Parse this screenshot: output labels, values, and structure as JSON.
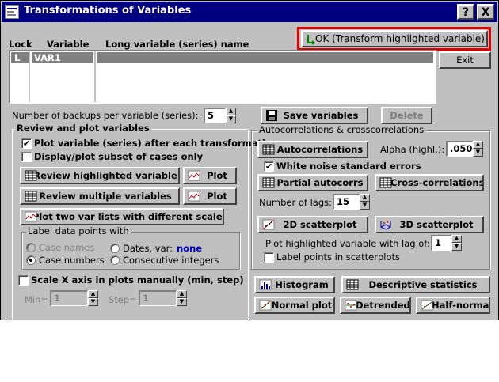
{
  "window": {
    "title": "Transformations of Variables",
    "help_label": "?",
    "close_label": "X"
  },
  "list": {
    "col_lock": "Lock",
    "col_variable": "Variable",
    "col_long": "Long variable (series) name",
    "rows": [
      {
        "lock": "L",
        "variable": "VAR1",
        "long_name": ""
      }
    ]
  },
  "buttons": {
    "ok": "OK (Transform highlighted variable)",
    "exit": "Exit",
    "save": "Save variables",
    "delete": "Delete",
    "review_highlighted": "Review highlighted variable",
    "review_multiple": "Review multiple variables",
    "plot1": "Plot",
    "plot2": "Plot",
    "plot_two": "Plot two var lists with different scales",
    "autocorrelations": "Autocorrelations",
    "partial": "Partial autocorrs",
    "cross": "Cross-correlations",
    "scatter2d": "2D scatterplot",
    "scatter3d": "3D scatterplot",
    "histogram": "Histogram",
    "descriptive": "Descriptive statistics",
    "normal": "Normal plot",
    "detrended": "Detrended",
    "halfnormal": "Half-normal"
  },
  "backups": {
    "label": "Number of backups per variable (series):",
    "value": "5"
  },
  "review": {
    "title": "Review and plot variables",
    "plot_after": "Plot variable (series) after each transformation",
    "plot_after_checked": "✔",
    "display_subset": "Display/plot subset of cases only"
  },
  "label_points": {
    "title": "Label data points with",
    "case_names": "Case names",
    "dates_var": "Dates, var:",
    "dates_value": "none",
    "case_numbers": "Case numbers",
    "consecutive": "Consecutive integers"
  },
  "scale_x": {
    "label": "Scale X axis in plots manually (min, step)",
    "min_label": "Min=",
    "min_value": "1",
    "step_label": "Step=",
    "step_value": "1"
  },
  "auto": {
    "title": "Autocorrelations & crosscorrelations",
    "alpha_label": "Alpha (highl.):",
    "alpha_value": ".050",
    "white_noise": "White noise standard errors",
    "white_noise_checked": "✔",
    "lags_label": "Number of lags:",
    "lags_value": "15",
    "lag_label": "Plot highlighted variable with lag of:",
    "lag_value": "1",
    "label_scatter": "Label points in scatterplots"
  },
  "colors": {
    "title_bar": "#000080",
    "face": "#c0c0c0",
    "highlight": "#e00000",
    "link_blue": "#0000c0"
  }
}
